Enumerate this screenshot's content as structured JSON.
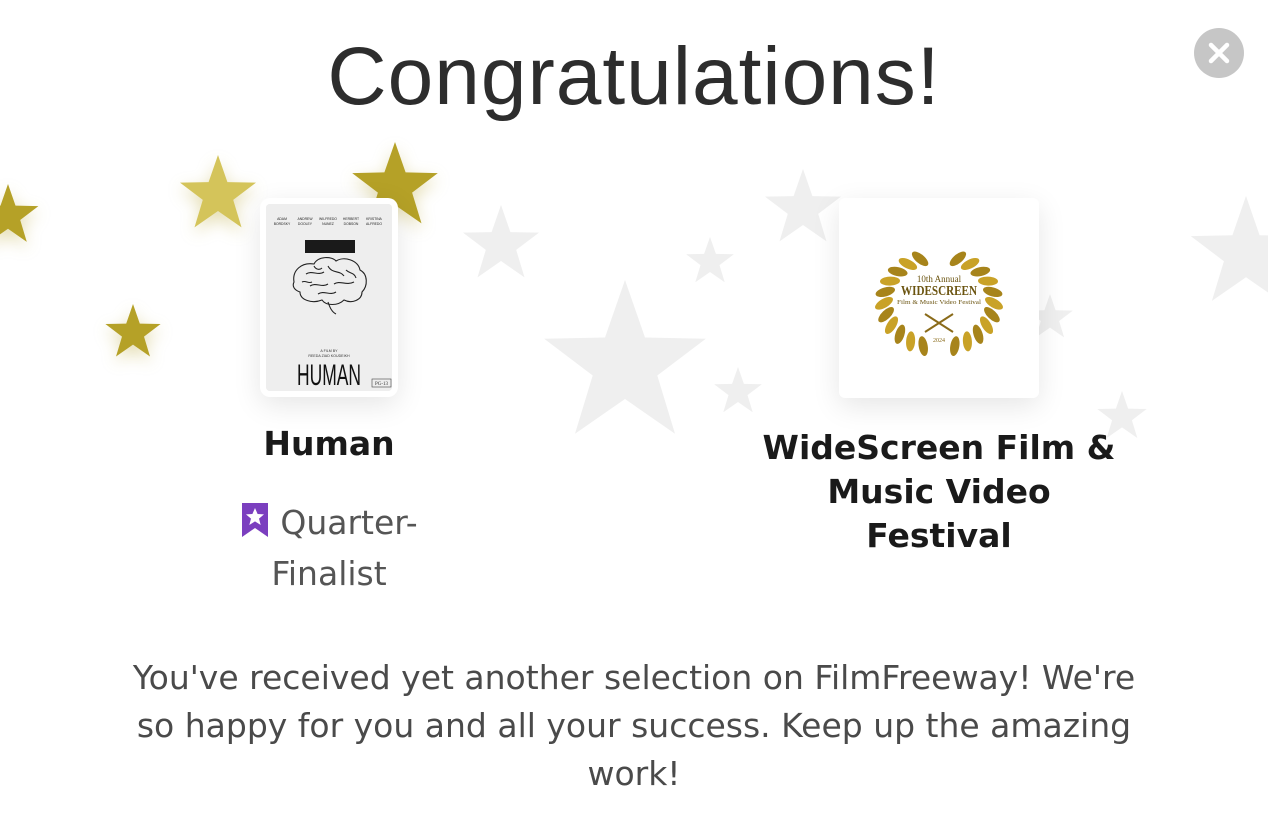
{
  "dialog": {
    "title": "Congratulations!",
    "close_icon": "close-icon"
  },
  "submission": {
    "film_title": "Human",
    "status_icon": "bookmark-star-icon",
    "status_label": "Quarter-Finalist",
    "poster": {
      "title_text": "HUMAN",
      "rating": "PG-13",
      "credits": [
        "A FILM BY",
        "REEDA ZIAD KOUDEIKH"
      ],
      "cast_names": [
        "ADAM BORDSKY",
        "ANDREW DOOLEY",
        "WILFREDO NUNEZ",
        "HERBERT DOBSON",
        "KRISTINA ALFREDO"
      ]
    }
  },
  "festival": {
    "name": "WideScreen Film & Music Video Festival",
    "laurel": {
      "top_line": "10th Annual",
      "name": "WIDESCREEN",
      "sub_line": "Film & Music Video Festival",
      "year": "2024"
    }
  },
  "message": "You've received yet another selection on FilmFreeway! We're so happy for you and all your success. Keep up the amazing work!",
  "colors": {
    "gold_star": "#b5a127",
    "light_gold_star": "#d4c45a",
    "grey_star": "#efefef",
    "badge_purple": "#7b3fbf",
    "close_button": "#c6c6c6"
  }
}
